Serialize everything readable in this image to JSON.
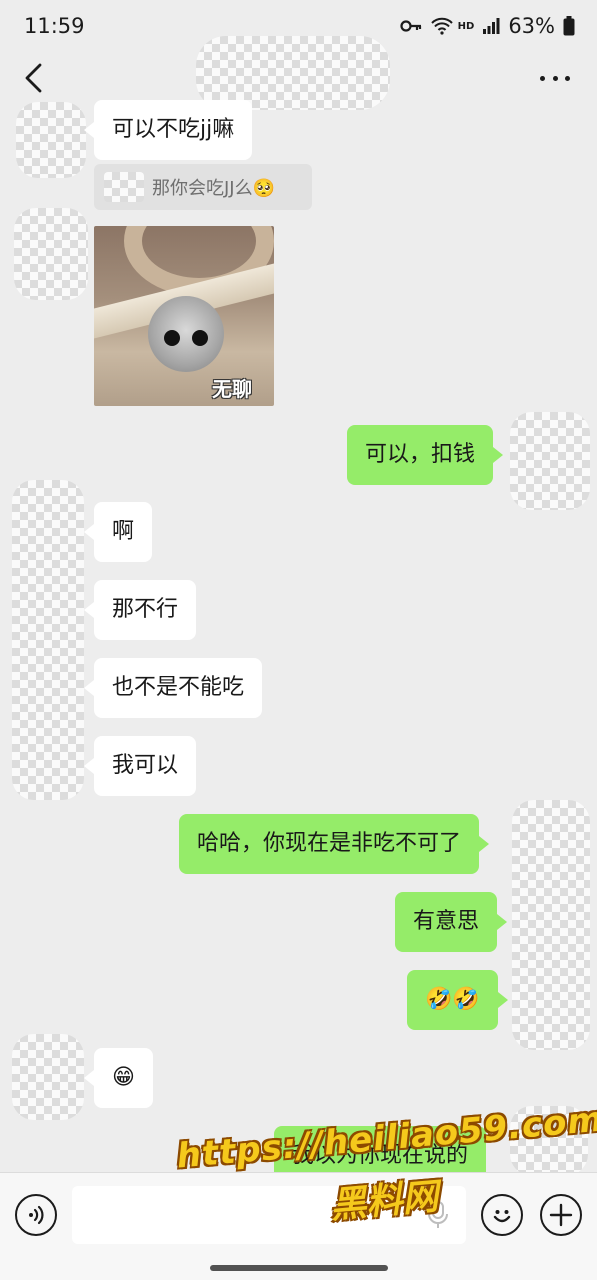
{
  "status_bar": {
    "time": "11:59",
    "battery": "63%",
    "network_badge": "HD",
    "icons": [
      "key-icon",
      "wifi-icon",
      "signal-icon",
      "battery-icon"
    ]
  },
  "header": {
    "icons": [
      "back-arrow-icon",
      "more-dots-icon"
    ]
  },
  "messages": {
    "m1": "可以不吃jj嘛",
    "quote": "那你会吃JJ么🥺",
    "sticker_caption": "无聊",
    "m2": "可以，扣钱",
    "m3": "啊",
    "m4": "那不行",
    "m5": "也不是不能吃",
    "m6": "我可以",
    "m7": "哈哈，你现在是非吃不可了",
    "m8": "有意思",
    "m9": "🤣🤣",
    "m10": "😁",
    "m11": "我以为你现在说的"
  },
  "watermark": {
    "url": "https://heiliao59.com",
    "name": "黑料网"
  },
  "input_bar": {
    "icons": [
      "voice-icon",
      "mic-icon",
      "emoji-icon",
      "plus-icon"
    ]
  },
  "colors": {
    "background": "#ededed",
    "bubble_out": "#95ec69",
    "bubble_in": "#ffffff"
  }
}
